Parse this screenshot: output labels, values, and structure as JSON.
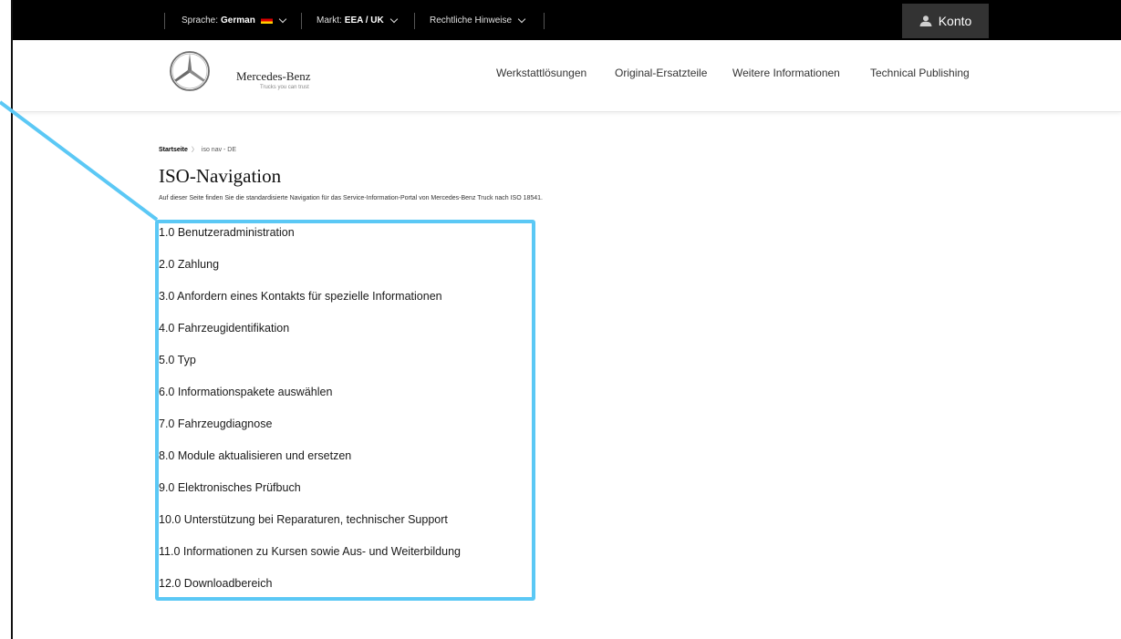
{
  "topbar": {
    "language_label": "Sprache:",
    "language_value": "German",
    "market_label": "Markt:",
    "market_value": "EEA / UK",
    "legal_label": "Rechtliche Hinweise",
    "account_label": "Konto"
  },
  "header": {
    "brand_name": "Mercedes-Benz",
    "brand_tagline": "Trucks you can trust",
    "nav": [
      "Werkstattlösungen",
      "Original-Ersatzteile",
      "Weitere Informationen",
      "Technical Publishing"
    ]
  },
  "breadcrumb": {
    "home": "Startseite",
    "current": "iso nav - DE"
  },
  "page": {
    "title": "ISO-Navigation",
    "intro": "Auf dieser Seite finden Sie die standardisierte Navigation für das Service-Information-Portal von Mercedes-Benz Truck nach ISO 18541."
  },
  "iso_items": [
    "1.0 Benutzeradministration",
    "2.0 Zahlung",
    "3.0 Anfordern eines Kontakts für spezielle Informationen",
    "4.0 Fahrzeugidentifikation",
    "5.0 Typ",
    "6.0 Informationspakete auswählen",
    "7.0 Fahrzeugdiagnose",
    "8.0 Module aktualisieren und ersetzen",
    "9.0 Elektronisches Prüfbuch",
    "10.0 Unterstützung bei Reparaturen, technischer Support",
    "11.0 Informationen zu Kursen sowie Aus- und Weiterbildung",
    "12.0 Downloadbereich"
  ],
  "colors": {
    "highlight": "#5bc8f5",
    "topbar_bg": "#000000",
    "account_bg": "#333333"
  }
}
